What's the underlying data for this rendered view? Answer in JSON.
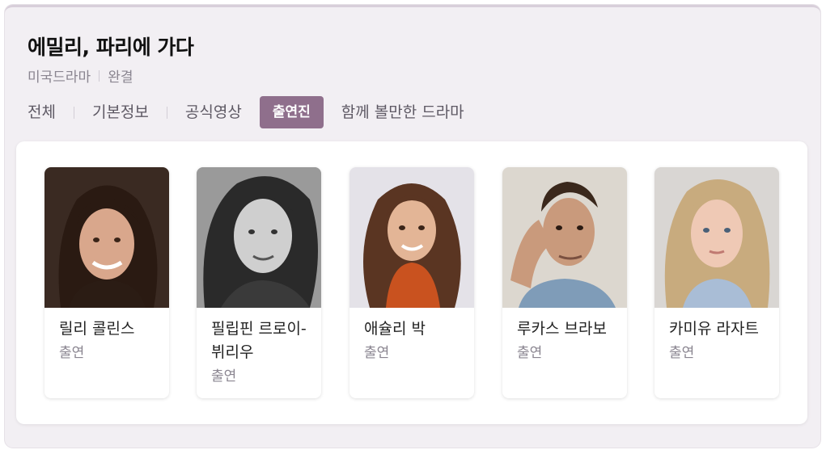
{
  "header": {
    "title": "에밀리, 파리에 가다",
    "category": "미국드라마",
    "status": "완결"
  },
  "tabs": [
    {
      "label": "전체",
      "active": false
    },
    {
      "label": "기본정보",
      "active": false
    },
    {
      "label": "공식영상",
      "active": false
    },
    {
      "label": "출연진",
      "active": true
    },
    {
      "label": "함께 볼만한 드라마",
      "active": false
    }
  ],
  "cast": [
    {
      "name": "릴리 콜린스",
      "role": "출연"
    },
    {
      "name": "필립핀 르로이-뷔리우",
      "role": "출연"
    },
    {
      "name": "애슐리 박",
      "role": "출연"
    },
    {
      "name": "루카스 브라보",
      "role": "출연"
    },
    {
      "name": "카미유 라자트",
      "role": "출연"
    }
  ],
  "colors": {
    "accent": "#8f6f8c",
    "card_bg": "#f2eff3"
  }
}
